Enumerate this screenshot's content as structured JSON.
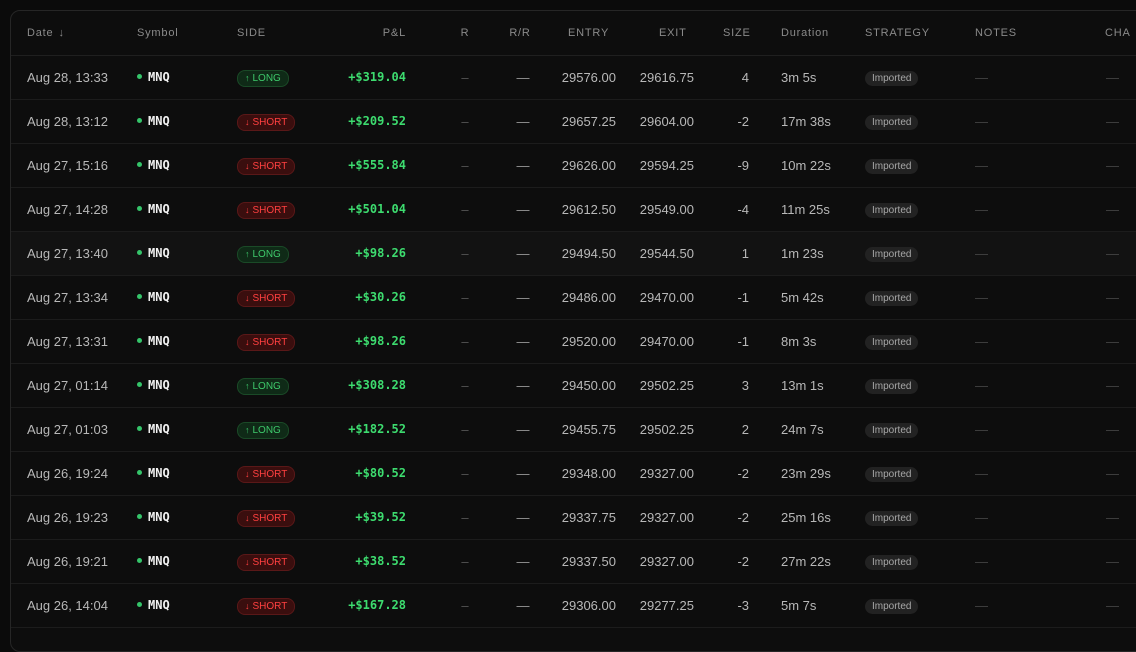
{
  "headers": {
    "date": "Date",
    "symbol": "Symbol",
    "side": "SIDE",
    "pnl": "P&L",
    "r": "R",
    "rr": "R/R",
    "entry": "ENTRY",
    "exit": "EXIT",
    "size": "SIZE",
    "duration": "Duration",
    "strategy": "STRATEGY",
    "notes": "NOTES",
    "chart": "CHA"
  },
  "sort_icon": "↓",
  "empty_dash": "—",
  "r_dash": "–",
  "colors": {
    "long": "#3ec96b",
    "short": "#ff4040",
    "profit": "#3ddc6f",
    "symbol_dot": "#35c46a"
  },
  "rows": [
    {
      "date": "Aug 28, 13:33",
      "symbol": "MNQ",
      "side": "LONG",
      "side_arrow": "↑",
      "pnl": "+$319.04",
      "entry": "29576.00",
      "exit": "29616.75",
      "size": "4",
      "duration": "3m 5s",
      "strategy": "Imported"
    },
    {
      "date": "Aug 28, 13:12",
      "symbol": "MNQ",
      "side": "SHORT",
      "side_arrow": "↓",
      "pnl": "+$209.52",
      "entry": "29657.25",
      "exit": "29604.00",
      "size": "-2",
      "duration": "17m 38s",
      "strategy": "Imported"
    },
    {
      "date": "Aug 27, 15:16",
      "symbol": "MNQ",
      "side": "SHORT",
      "side_arrow": "↓",
      "pnl": "+$555.84",
      "entry": "29626.00",
      "exit": "29594.25",
      "size": "-9",
      "duration": "10m 22s",
      "strategy": "Imported"
    },
    {
      "date": "Aug 27, 14:28",
      "symbol": "MNQ",
      "side": "SHORT",
      "side_arrow": "↓",
      "pnl": "+$501.04",
      "entry": "29612.50",
      "exit": "29549.00",
      "size": "-4",
      "duration": "11m 25s",
      "strategy": "Imported"
    },
    {
      "date": "Aug 27, 13:40",
      "symbol": "MNQ",
      "side": "LONG",
      "side_arrow": "↑",
      "pnl": "+$98.26",
      "entry": "29494.50",
      "exit": "29544.50",
      "size": "1",
      "duration": "1m 23s",
      "strategy": "Imported"
    },
    {
      "date": "Aug 27, 13:34",
      "symbol": "MNQ",
      "side": "SHORT",
      "side_arrow": "↓",
      "pnl": "+$30.26",
      "entry": "29486.00",
      "exit": "29470.00",
      "size": "-1",
      "duration": "5m 42s",
      "strategy": "Imported"
    },
    {
      "date": "Aug 27, 13:31",
      "symbol": "MNQ",
      "side": "SHORT",
      "side_arrow": "↓",
      "pnl": "+$98.26",
      "entry": "29520.00",
      "exit": "29470.00",
      "size": "-1",
      "duration": "8m 3s",
      "strategy": "Imported"
    },
    {
      "date": "Aug 27, 01:14",
      "symbol": "MNQ",
      "side": "LONG",
      "side_arrow": "↑",
      "pnl": "+$308.28",
      "entry": "29450.00",
      "exit": "29502.25",
      "size": "3",
      "duration": "13m 1s",
      "strategy": "Imported"
    },
    {
      "date": "Aug 27, 01:03",
      "symbol": "MNQ",
      "side": "LONG",
      "side_arrow": "↑",
      "pnl": "+$182.52",
      "entry": "29455.75",
      "exit": "29502.25",
      "size": "2",
      "duration": "24m 7s",
      "strategy": "Imported"
    },
    {
      "date": "Aug 26, 19:24",
      "symbol": "MNQ",
      "side": "SHORT",
      "side_arrow": "↓",
      "pnl": "+$80.52",
      "entry": "29348.00",
      "exit": "29327.00",
      "size": "-2",
      "duration": "23m 29s",
      "strategy": "Imported"
    },
    {
      "date": "Aug 26, 19:23",
      "symbol": "MNQ",
      "side": "SHORT",
      "side_arrow": "↓",
      "pnl": "+$39.52",
      "entry": "29337.75",
      "exit": "29327.00",
      "size": "-2",
      "duration": "25m 16s",
      "strategy": "Imported"
    },
    {
      "date": "Aug 26, 19:21",
      "symbol": "MNQ",
      "side": "SHORT",
      "side_arrow": "↓",
      "pnl": "+$38.52",
      "entry": "29337.50",
      "exit": "29327.00",
      "size": "-2",
      "duration": "27m 22s",
      "strategy": "Imported"
    },
    {
      "date": "Aug 26, 14:04",
      "symbol": "MNQ",
      "side": "SHORT",
      "side_arrow": "↓",
      "pnl": "+$167.28",
      "entry": "29306.00",
      "exit": "29277.25",
      "size": "-3",
      "duration": "5m 7s",
      "strategy": "Imported"
    }
  ]
}
